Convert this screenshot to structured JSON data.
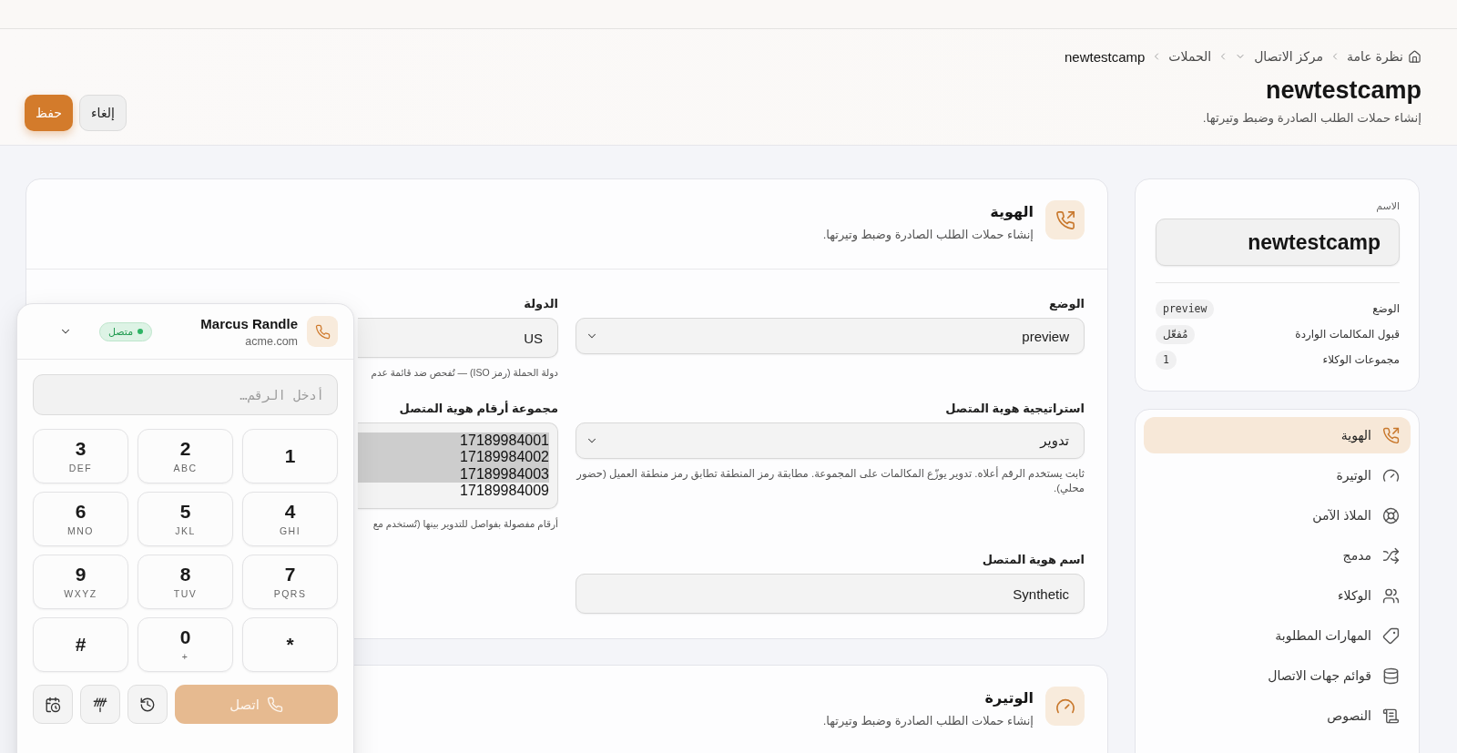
{
  "header": {
    "breadcrumb": [
      {
        "label": "نظرة عامة",
        "kind": "home"
      },
      {
        "label": "مركز الاتصال",
        "kind": "dropdown"
      },
      {
        "label": "الحملات",
        "kind": "link"
      },
      {
        "label": "newtestcamp",
        "kind": "current"
      }
    ],
    "title": "newtestcamp",
    "subtitle": "إنشاء حملات الطلب الصادرة وضبط وتيرتها.",
    "buttons": [
      {
        "label": "إلغاء",
        "kind": "secondary"
      },
      {
        "label": "حفظ",
        "kind": "primary"
      }
    ]
  },
  "summary": {
    "name_label": "الاسم",
    "name_value": "newtestcamp",
    "rows": [
      {
        "label": "الوضع",
        "value": "preview",
        "kind": "code"
      },
      {
        "label": "قبول المكالمات الواردة",
        "value": "مُفعّل",
        "kind": "tag"
      },
      {
        "label": "مجموعات الوكلاء",
        "value": "1",
        "kind": "code"
      }
    ]
  },
  "section_nav": [
    {
      "label": "الهوية",
      "selected": true
    },
    {
      "label": "الوتيرة",
      "selected": false
    },
    {
      "label": "الملاذ الآمن",
      "selected": false
    },
    {
      "label": "مدمج",
      "selected": false
    },
    {
      "label": "الوكلاء",
      "selected": false
    },
    {
      "label": "المهارات المطلوبة",
      "selected": false
    },
    {
      "label": "قوائم جهات الاتصال",
      "selected": false
    },
    {
      "label": "النصوص",
      "selected": false
    }
  ],
  "sections": [
    {
      "title": "الهوية",
      "subtitle": "إنشاء حملات الطلب الصادرة وضبط وتيرتها.",
      "fields": [
        {
          "kind": "select",
          "label": "الوضع",
          "value": "preview"
        },
        {
          "kind": "input",
          "label": "الدولة",
          "value": "US",
          "help": "دولة الحملة (رمز ISO) — تُفحص ضد قائمة عدم"
        },
        {
          "kind": "select",
          "label": "استراتيجية هوية المتصل",
          "value": "تدوير",
          "help": "ثابت يستخدم الرقم أعلاه. تدوير يوزّع المكالمات على المجموعة. مطابقة رمز المنطقة تطابق رمز منطقة العميل (حضور محلي)."
        },
        {
          "kind": "textarea",
          "label": "مجموعة أرقام هوية المتصل",
          "lines": [
            {
              "text": "17189984001",
              "selected": true
            },
            {
              "text": "17189984002",
              "selected": true
            },
            {
              "text": "17189984003",
              "selected": true
            },
            {
              "text": "17189984009",
              "selected": false
            }
          ],
          "help": "أرقام مفصولة بفواصل للتدوير بينها (تُستخدم مع"
        },
        {
          "kind": "input",
          "label": "اسم هوية المتصل",
          "value": "Synthetic"
        }
      ]
    },
    {
      "title": "الوتيرة",
      "subtitle": "إنشاء حملات الطلب الصادرة وضبط وتيرتها."
    }
  ],
  "dialer": {
    "name": "Marcus Randle",
    "domain": "acme.com",
    "status": {
      "label": "متصل",
      "online": true
    },
    "number_field": {
      "placeholder": "أدخل الرقم…"
    },
    "keys": [
      {
        "digit": "1"
      },
      {
        "digit": "2",
        "letters": "ABC"
      },
      {
        "digit": "3",
        "letters": "DEF"
      },
      {
        "digit": "4",
        "letters": "GHI"
      },
      {
        "digit": "5",
        "letters": "JKL"
      },
      {
        "digit": "6",
        "letters": "MNO"
      },
      {
        "digit": "7",
        "letters": "PQRS"
      },
      {
        "digit": "8",
        "letters": "TUV"
      },
      {
        "digit": "9",
        "letters": "WXYZ"
      },
      {
        "digit": "*"
      },
      {
        "digit": "0",
        "letters": "+"
      },
      {
        "digit": "#"
      }
    ],
    "call_button": {
      "label": "اتصل",
      "disabled": true
    }
  }
}
